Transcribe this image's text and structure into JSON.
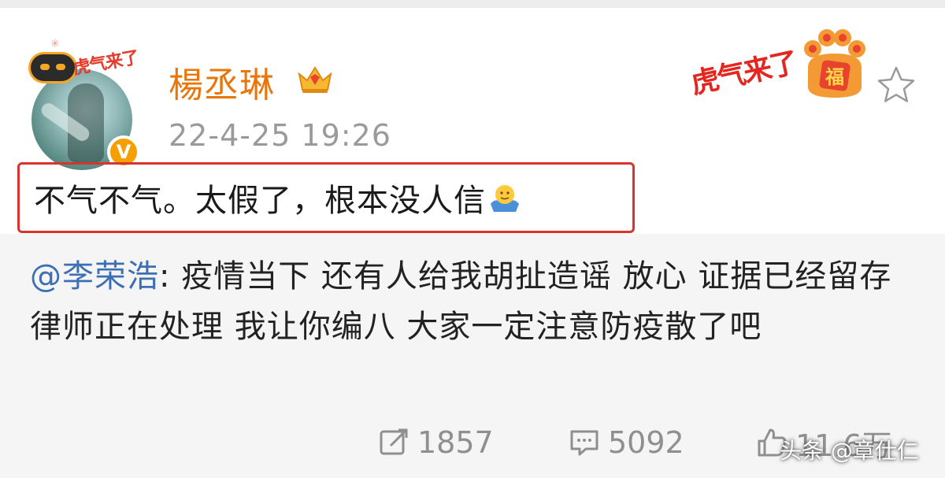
{
  "user": {
    "name": "楊丞琳",
    "timestamp": "22-4-25 19:26",
    "avatar_badge_text": "虎气来了",
    "verified_mark": "V"
  },
  "festival_badge": {
    "text": "虎气来了",
    "paw_text": "福"
  },
  "post": {
    "text": "不气不气。太假了，根本没人信"
  },
  "quoted": {
    "mention": "@李荣浩",
    "text": ": 疫情当下 还有人给我胡扯造谣 放心 证据已经留存 律师正在处理 我让你编八 大家一定注意防疫散了吧"
  },
  "actions": {
    "repost_count": "1857",
    "comment_count": "5092",
    "like_count": "11.6万"
  },
  "watermark": "头条 @章仕仁",
  "colors": {
    "username": "#e8760a",
    "mention": "#3d6fb4",
    "highlight_border": "#d9332f",
    "verified": "#f5a000"
  }
}
